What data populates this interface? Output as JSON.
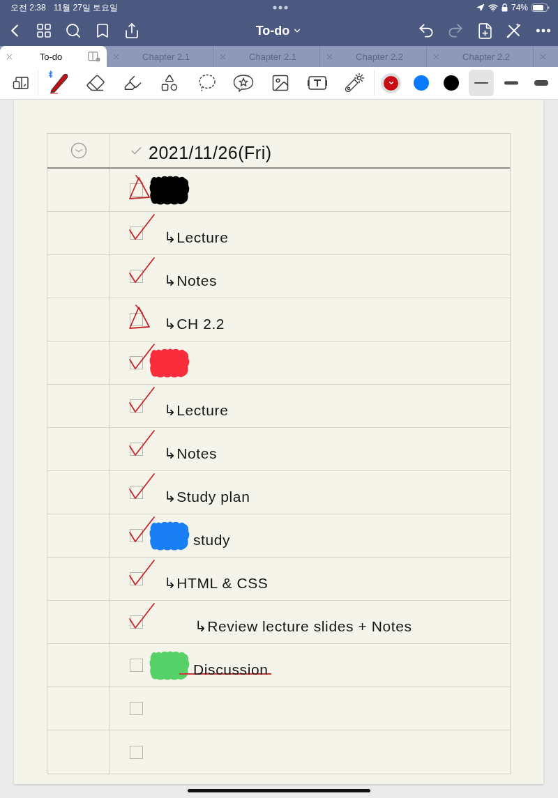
{
  "status_bar": {
    "time": "오전 2:38",
    "date": "11월 27일 토요일",
    "battery": "74%"
  },
  "nav": {
    "title": "To-do",
    "left": [
      {
        "kind": "back"
      },
      {
        "kind": "grid"
      },
      {
        "kind": "search"
      },
      {
        "kind": "bookmark"
      },
      {
        "kind": "share"
      }
    ],
    "right": [
      {
        "kind": "undo",
        "disabled": false
      },
      {
        "kind": "redo",
        "disabled": true
      },
      {
        "kind": "add_page",
        "disabled": false
      },
      {
        "kind": "pen_cross",
        "disabled": false
      },
      {
        "kind": "more",
        "disabled": false
      }
    ]
  },
  "tabs": [
    {
      "label": "To-do",
      "selected": true
    },
    {
      "label": "Chapter 2.1",
      "selected": false
    },
    {
      "label": "Chapter 2.1",
      "selected": false
    },
    {
      "label": "Chapter 2.2",
      "selected": false
    },
    {
      "label": "Chapter 2.2",
      "selected": false
    },
    {
      "selected": false
    }
  ],
  "toolbar": {
    "tools": [
      {
        "kind": "pen",
        "selected": true
      },
      {
        "kind": "eraser",
        "selected": false
      },
      {
        "kind": "highlighter",
        "selected": false
      },
      {
        "kind": "shapes",
        "selected": false
      },
      {
        "kind": "lasso",
        "selected": false
      },
      {
        "kind": "sticker",
        "selected": false
      },
      {
        "kind": "image",
        "selected": false
      },
      {
        "kind": "text",
        "selected": false
      },
      {
        "kind": "laser",
        "selected": false
      }
    ],
    "colors": [
      {
        "color": "#c70d13",
        "selected": true
      },
      {
        "color": "#0a7aff",
        "selected": false
      },
      {
        "color": "#000000",
        "selected": false
      }
    ],
    "widths": [
      {
        "kind": "thin",
        "selected": true
      },
      {
        "kind": "medium",
        "selected": false
      },
      {
        "kind": "thick",
        "selected": false
      }
    ]
  },
  "page": {
    "header": {
      "date": "2021/11/26(Fri)"
    },
    "rows": [
      {
        "checked": false,
        "partial": true,
        "struck": false,
        "scribble": {
          "color": "#000000"
        },
        "children": [
          {
            "checked": true,
            "partial": false,
            "struck": false,
            "text": "↳Lecture"
          },
          {
            "checked": true,
            "partial": false,
            "struck": false,
            "text": "↳Notes"
          },
          {
            "checked": false,
            "partial": true,
            "struck": false,
            "text": "↳CH 2.2"
          }
        ]
      },
      {
        "checked": true,
        "partial": false,
        "struck": false,
        "scribble": {
          "color": "#fa2d3d"
        },
        "children": [
          {
            "checked": true,
            "partial": false,
            "struck": false,
            "text": "↳Lecture"
          },
          {
            "checked": true,
            "partial": false,
            "struck": false,
            "text": "↳Notes"
          },
          {
            "checked": true,
            "partial": false,
            "struck": false,
            "text": "↳Study plan"
          }
        ]
      },
      {
        "checked": true,
        "partial": false,
        "struck": false,
        "scribble": {
          "color": "#1a7ff5"
        },
        "text": "study",
        "children": [
          {
            "checked": true,
            "partial": false,
            "struck": false,
            "text": "↳HTML & CSS",
            "children": [
              {
                "checked": true,
                "partial": false,
                "struck": false,
                "text": "↳Review lecture slides + Notes"
              }
            ]
          }
        ]
      },
      {
        "checked": false,
        "partial": false,
        "struck": true,
        "scribble": {
          "color": "#55d168"
        },
        "text": "Discussion"
      },
      {
        "checked": false,
        "partial": false,
        "struck": false
      },
      {
        "checked": false,
        "partial": false,
        "struck": false
      }
    ]
  }
}
